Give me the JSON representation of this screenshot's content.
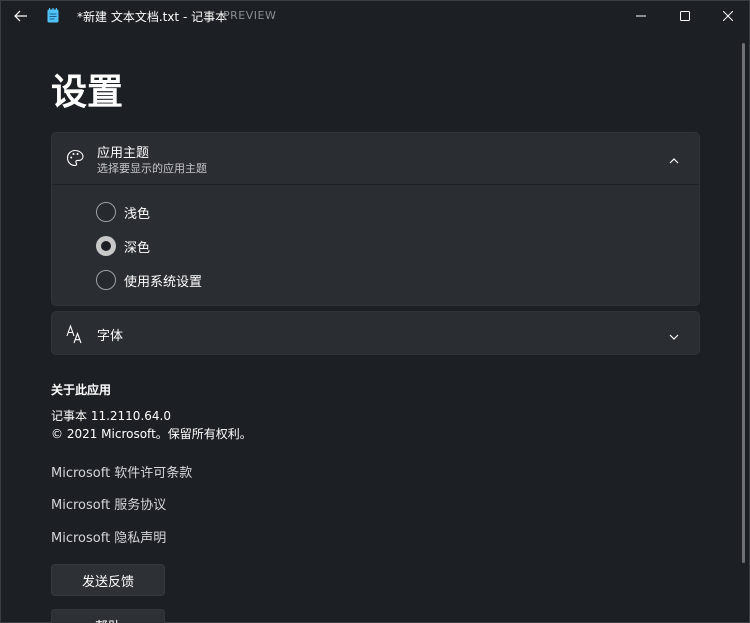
{
  "titlebar": {
    "title": "*新建 文本文档.txt - 记事本",
    "preview": "PREVIEW",
    "icons": {
      "back": "back-arrow-icon",
      "app": "notepad-icon",
      "minimize": "minimize-icon",
      "maximize": "maximize-icon",
      "close": "close-icon"
    }
  },
  "page": {
    "title": "设置"
  },
  "theme_card": {
    "icon": "palette-icon",
    "title": "应用主题",
    "subtitle": "选择要显示的应用主题",
    "expanded": true,
    "options": [
      {
        "label": "浅色",
        "checked": false
      },
      {
        "label": "深色",
        "checked": true
      },
      {
        "label": "使用系统设置",
        "checked": false
      }
    ]
  },
  "font_card": {
    "icon": "font-icon",
    "title": "字体",
    "expanded": false
  },
  "about": {
    "heading": "关于此应用",
    "version": "记事本 11.2110.64.0",
    "copyright": "© 2021 Microsoft。保留所有权利。",
    "links": {
      "license": "Microsoft 软件许可条款",
      "service": "Microsoft 服务协议",
      "privacy": "Microsoft 隐私声明"
    },
    "buttons": {
      "feedback": "发送反馈",
      "help": "帮助"
    }
  },
  "colors": {
    "background": "#1c1f24",
    "card": "#2a2d32",
    "text": "#ffffff",
    "secondary_text": "#c5c7ca",
    "radio_checked": "#c8c8c8"
  }
}
